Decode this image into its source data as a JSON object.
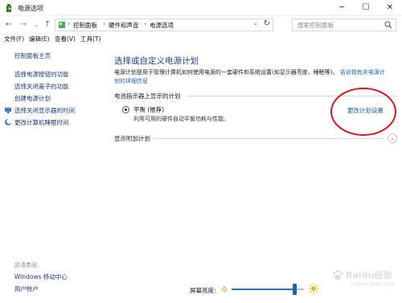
{
  "window": {
    "title": "电源选项",
    "icon": "power-options-icon"
  },
  "address": {
    "breadcrumb": [
      "控制面板",
      "硬件和声音",
      "电源选项"
    ],
    "search_placeholder": "搜索控制面板"
  },
  "menu": {
    "items": [
      "文件(F)",
      "编辑(E)",
      "查看(V)",
      "工具(T)"
    ]
  },
  "sidebar": {
    "home": "控制面板主页",
    "links": [
      {
        "label": "选择电源按钮的功能",
        "icon": ""
      },
      {
        "label": "选择关闭盖子的功能",
        "icon": ""
      },
      {
        "label": "创建电源计划",
        "icon": ""
      },
      {
        "label": "选择关闭显示器的时间",
        "icon": "power-display-icon"
      },
      {
        "label": "更改计算机睡眠时间",
        "icon": "power-sleep-icon"
      }
    ],
    "see_also_title": "另请参阅",
    "see_also": [
      "Windows 移动中心",
      "用户帐户"
    ]
  },
  "main": {
    "heading": "选择或自定义电源计划",
    "description": "电源计划是用于管理计算机如何使用电源的一套硬件和系统设置(如显示器亮度、睡眠等)。",
    "description_link": "告诉我有关电源计划的详细信息",
    "section_battery": "电池指示器上显示的计划",
    "plan": {
      "name": "平衡 (推荐)",
      "description": "利用可用的硬件自动平衡功耗与性能。",
      "change_link": "更改计划设置",
      "selected": true
    },
    "section_extra": "显示附加计划"
  },
  "status": {
    "brightness_label": "屏幕亮度:",
    "brightness_level": 0.87
  },
  "watermark": {
    "text": "Baidu经验",
    "sub": "jingyan.baidu.com"
  },
  "colors": {
    "link": "#1a5fb4",
    "heading": "#1e3f8f",
    "highlight": "#e0151b",
    "slider": "#1565c0"
  }
}
